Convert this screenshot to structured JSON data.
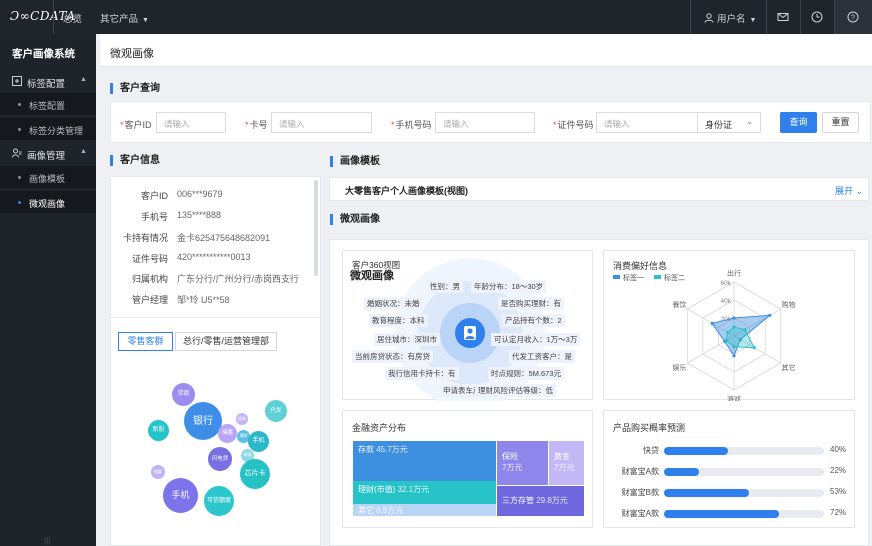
{
  "topbar": {
    "logo": "Ɔ∞CDATA",
    "nav": [
      "总览",
      "其它产品"
    ],
    "user": "用户名",
    "icons": [
      "mail-icon",
      "clock-icon",
      "help-icon"
    ]
  },
  "sidebar": {
    "title": "客户画像系统",
    "groups": [
      {
        "label": "标签配置",
        "icon": "tag-config-icon",
        "items": [
          "标签配置",
          "标签分类管理"
        ]
      },
      {
        "label": "画像管理",
        "icon": "portrait-manage-icon",
        "items": [
          "画像模板",
          "微观画像"
        ]
      }
    ],
    "active_item": "微观画像",
    "bottom_mark": "|||"
  },
  "page": {
    "title": "微观画像"
  },
  "query": {
    "section_title": "客户查询",
    "fields": [
      {
        "label": "客户ID",
        "placeholder": "请输入"
      },
      {
        "label": "卡号",
        "placeholder": "请输入"
      },
      {
        "label": "手机号码",
        "placeholder": "请输入"
      },
      {
        "label": "证件号码",
        "placeholder": "请输入"
      }
    ],
    "id_type": "身份证",
    "search_label": "查询",
    "reset_label": "重置",
    "required_mark": "*"
  },
  "customer_info": {
    "section_title": "客户信息",
    "rows": [
      {
        "k": "客户ID",
        "v": "006***9679"
      },
      {
        "k": "手机号",
        "v": "135****888"
      },
      {
        "k": "卡持有情况",
        "v": "金卡625475648682091"
      },
      {
        "k": "证件号码",
        "v": "420***********0013"
      },
      {
        "k": "归属机构",
        "v": "广东分行/广州分行/赤岗西支行"
      },
      {
        "k": "管户经理",
        "v": "邹*玲 U5**58"
      }
    ],
    "tabs": [
      "零售客群",
      "总行/零售/运营管理部"
    ],
    "bubbles": [
      "贷款",
      "银行",
      "新股",
      "储蓄",
      "债券",
      "理财",
      "手机",
      "闪电贷",
      "芯片卡",
      "网银",
      "手机",
      "可信额度",
      "代发"
    ]
  },
  "template": {
    "section_title": "画像模板",
    "name": "大零售客户个人画像模板(视图)",
    "expand_label": "展开"
  },
  "micro": {
    "section_title": "微观画像",
    "view360": {
      "title": "客户360视图",
      "subtitle": "微观画像",
      "tags": [
        "性别：男",
        "年龄分布：18～30岁",
        "婚姻状况：未婚",
        "是否购买理财：有",
        "教育程度：本科",
        "产品持有个数：2",
        "居住城市：深圳市",
        "可认定月收入：1万～3万",
        "当前房贷状态：有房贷",
        "代发工资客户：是",
        "我行信用卡持卡：有",
        "时点规则：5M.673元",
        "申请表车产：无",
        "理财风险评估等级：低"
      ]
    },
    "consume": {
      "title": "消费偏好信息",
      "legend": [
        "标签一",
        "标签二"
      ],
      "axes": [
        "出行",
        "购物",
        "其它",
        "游戏",
        "娱乐",
        "餐饮"
      ],
      "ticks": [
        "60k",
        "40k",
        "20k"
      ],
      "colors": [
        "#3d8fe0",
        "#2bc0c4"
      ]
    },
    "assets": {
      "title": "金融资产分布",
      "cells": [
        {
          "name": "存款",
          "value": "45.7万元"
        },
        {
          "name": "理财(市值)",
          "value": "32.1万元"
        },
        {
          "name": "其它",
          "value": "6.8万元"
        },
        {
          "name": "保险",
          "value": "7万元"
        },
        {
          "name": "黄金",
          "value": "7万元"
        },
        {
          "name": "三方存管",
          "value": "29.8万元"
        }
      ]
    },
    "forecast": {
      "title": "产品购买概率预测",
      "rows": [
        {
          "k": "快贷",
          "v": "40%",
          "p": 0.4
        },
        {
          "k": "财富宝A款",
          "v": "22%",
          "p": 0.22
        },
        {
          "k": "财富宝B款",
          "v": "53%",
          "p": 0.53
        },
        {
          "k": "财富宝A款",
          "v": "72%",
          "p": 0.72
        }
      ]
    }
  },
  "chart_data": {
    "type": "radar",
    "title": "消费偏好信息",
    "categories": [
      "出行",
      "购物",
      "其它",
      "游戏",
      "娱乐",
      "餐饮"
    ],
    "rlim": [
      0,
      60
    ],
    "ticks": [
      "20k",
      "40k",
      "60k"
    ],
    "legend_position": "top-left",
    "series": [
      {
        "name": "标签一",
        "values": [
          20,
          46,
          8,
          22,
          12,
          28
        ]
      },
      {
        "name": "标签二",
        "values": [
          10,
          14,
          26,
          12,
          10,
          8
        ]
      }
    ]
  }
}
